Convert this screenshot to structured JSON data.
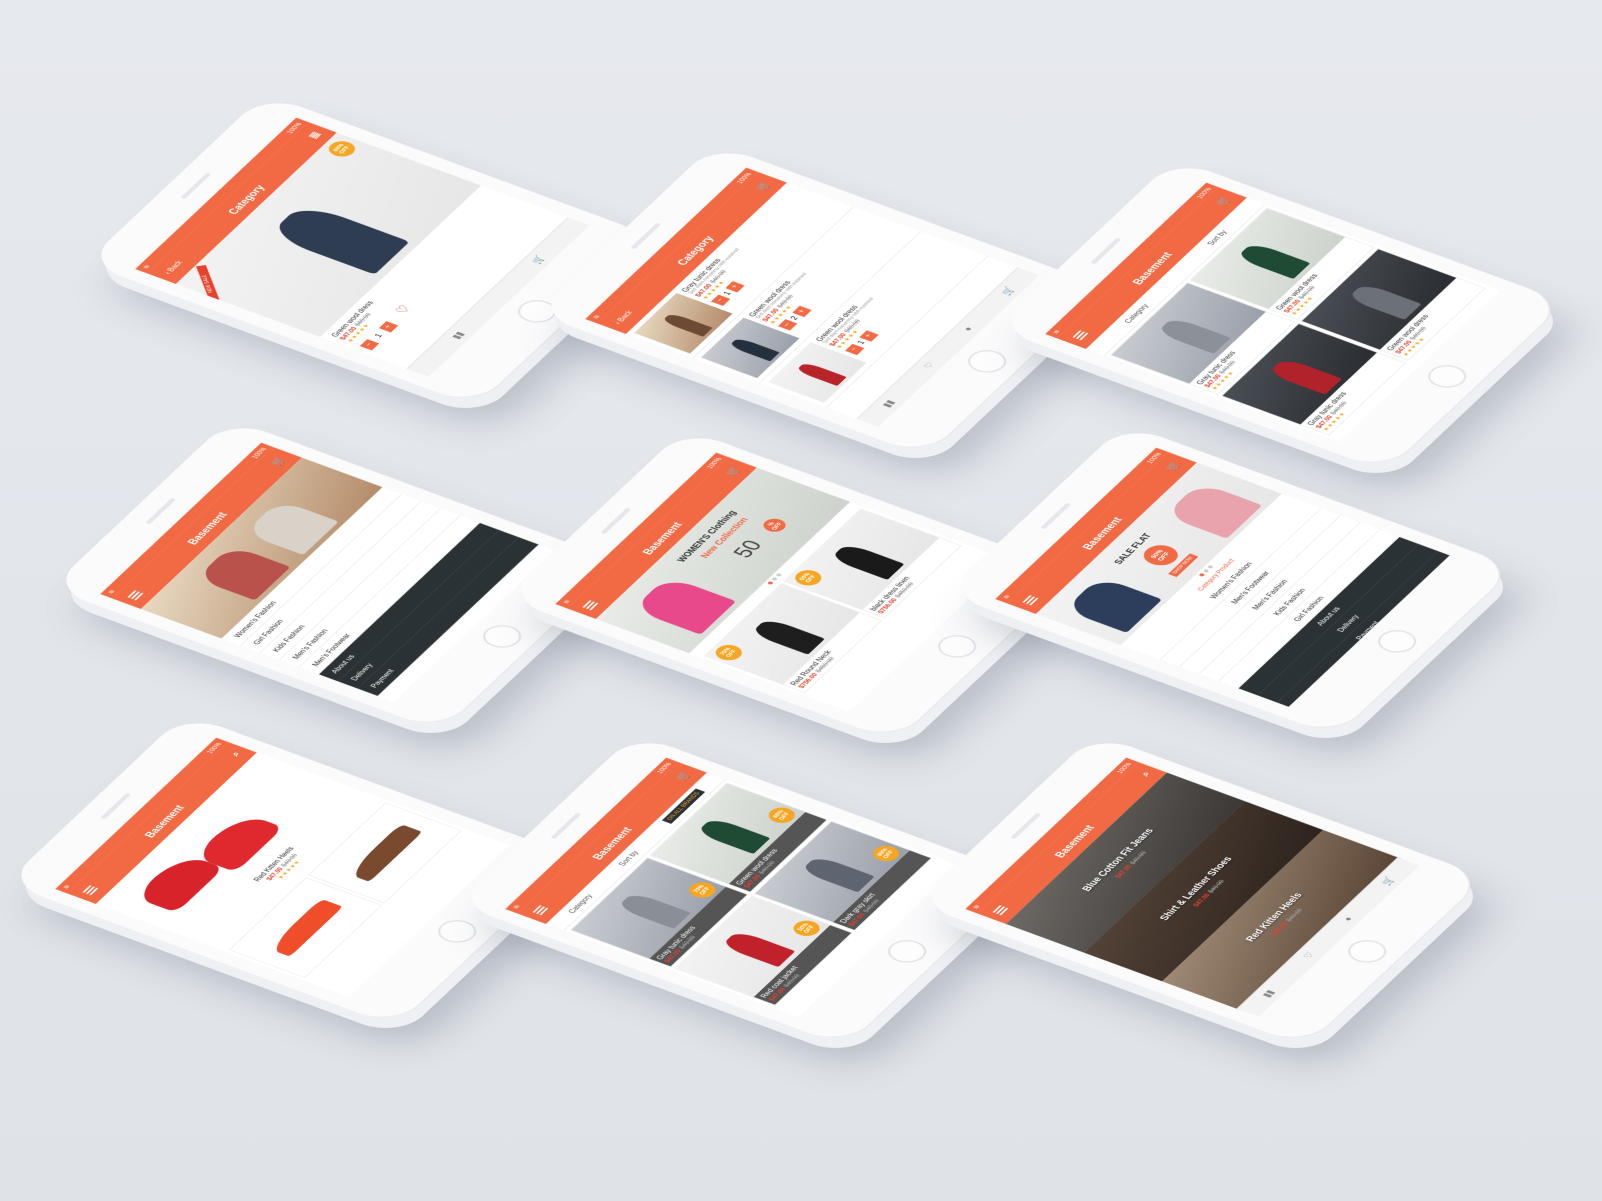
{
  "colors": {
    "accent": "#f26a44",
    "badge": "#f5a623",
    "price": "#e8412c",
    "menu_dark": "#2b3236",
    "background": "#e3e6eb"
  },
  "common": {
    "battery": "100%",
    "cart_count": "3",
    "app_name": "Basement",
    "sort_by": "Sort by",
    "category": "Category",
    "back": "Back",
    "stars": "★★★★★"
  },
  "screen_detail": {
    "title": "Category",
    "badge_pct": "60%",
    "badge_off": "OFF",
    "ribbon": "NEW SALE",
    "product_name": "Green wool dress",
    "price": "$47.00",
    "old_price": "$40.00",
    "qty": "1",
    "minus": "−",
    "plus": "+"
  },
  "screen_list": {
    "title": "Category",
    "items": [
      {
        "name": "Gray tunic dress",
        "desc": "Sed diam nonummy nibh euismod",
        "price": "$47.00",
        "old_price": "$40.00",
        "qty": "1"
      },
      {
        "name": "Green wool dress",
        "desc": "Sed diam nonummy nibh euismod",
        "price": "$47.00",
        "old_price": "$40.00",
        "qty": "2"
      },
      {
        "name": "Green wool dress",
        "desc": "Sed diam nonummy nibh euismod",
        "price": "$47.00",
        "old_price": "$40.00",
        "qty": "1"
      }
    ]
  },
  "screen_grid": {
    "items": [
      {
        "name": "Gray tunic dress",
        "price": "$47.00",
        "old_price": "$40.00"
      },
      {
        "name": "Green wool dress",
        "price": "$47.00",
        "old_price": "$40.00"
      },
      {
        "name": "Gray tunic dress",
        "price": "$47.00",
        "old_price": "$40.00"
      },
      {
        "name": "Green wool dress",
        "price": "$47.00",
        "old_price": "$40.00"
      }
    ]
  },
  "screen_menu": {
    "items": [
      "Women's Fashion",
      "Girl Fashion",
      "Kids Fashion",
      "Men's Fashion",
      "Men's Footwear"
    ],
    "dark_items": [
      "About us",
      "Delivery",
      "Payment"
    ]
  },
  "screen_home": {
    "banner_line1": "WOMEN'S Clothing",
    "banner_line2": "New Collection",
    "banner_num": "50",
    "banner_pct": "%",
    "banner_off": "OFF",
    "products": [
      {
        "name": "Red Round Neck",
        "price": "$756.00",
        "old_price": "$450.00",
        "badge": "70% OFF"
      },
      {
        "name": "black dress linen",
        "price": "$756.00",
        "old_price": "$450.00",
        "badge": "60% OFF"
      },
      {
        "name": "",
        "price": "",
        "old_price": "",
        "badge": "50% OFF"
      },
      {
        "name": "",
        "price": "",
        "old_price": "",
        "badge": "80% OFF"
      }
    ]
  },
  "screen_sale": {
    "sale_flat": "SALE FLAT",
    "pct": "50%",
    "off": "OFF",
    "shop_now": "SHOP NOW",
    "category_heading": "Category Product",
    "items": [
      "Women's Fashion",
      "Men's Footwear",
      "Men's Fashion",
      "Kids Fashion",
      "Girl Fashion"
    ],
    "dark_items": [
      "About us",
      "Delivery",
      "Payment"
    ]
  },
  "screen_shoes": {
    "hero_name": "Red Kitten Heels",
    "hero_price": "$47.00",
    "hero_old": "$40.00"
  },
  "screen_brands": {
    "brands_badge": "ON ALL BRANDS",
    "items": [
      {
        "name": "Gray tunic dress",
        "price": "$47.00",
        "old_price": "$40.00",
        "badge": "70% OFF"
      },
      {
        "name": "Green wool dress",
        "price": "$47.00",
        "old_price": "$40.00",
        "badge": "60% OFF"
      },
      {
        "name": "Red coat jacket",
        "price": "$47.00",
        "old_price": "$40.00",
        "badge": "50% OFF"
      },
      {
        "name": "Dark gray skirt",
        "price": "$47.00",
        "old_price": "$40.00",
        "badge": "80% OFF"
      }
    ]
  },
  "screen_feature": {
    "items": [
      {
        "name": "Blue Cotton Fit Jeans",
        "price": "$47.00",
        "old_price": "$40.00"
      },
      {
        "name": "Shirt & Leather Shoes",
        "price": "$47.00",
        "old_price": "$40.00"
      },
      {
        "name": "Red Kitten Heels",
        "price": "$47.00",
        "old_price": "$40.00"
      }
    ]
  }
}
